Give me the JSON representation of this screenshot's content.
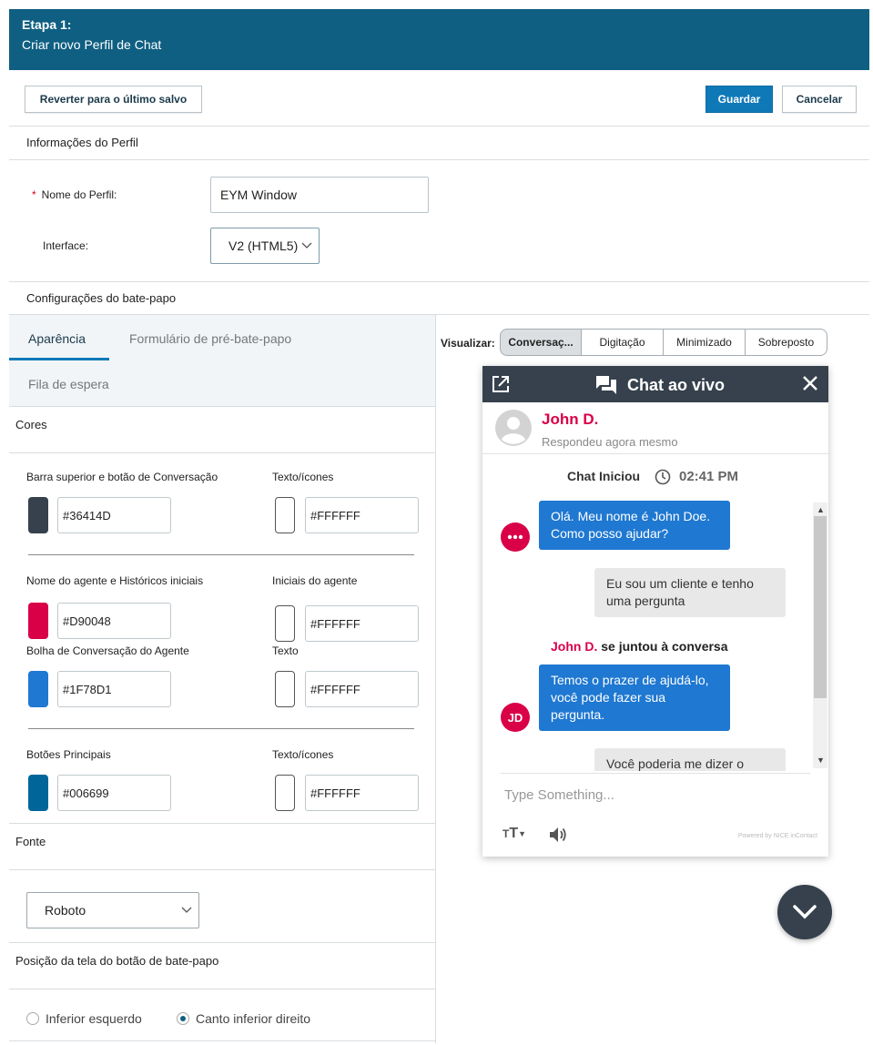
{
  "header": {
    "step": "Etapa 1:",
    "subtitle": "Criar novo Perfil de Chat"
  },
  "toolbar": {
    "revert_label": "Reverter para o último salvo",
    "save_label": "Guardar",
    "cancel_label": "Cancelar"
  },
  "profile_info": {
    "title": "Informações do Perfil",
    "name_label": "Nome do Perfil:",
    "name_value": "EYM Window",
    "interface_label": "Interface:",
    "interface_value": "V2 (HTML5)"
  },
  "chat_settings": {
    "title": "Configurações do bate-papo"
  },
  "tabs": [
    {
      "label": "Aparência",
      "active": true
    },
    {
      "label": "Formulário de pré-bate-papo",
      "active": false
    },
    {
      "label": "Fila de espera",
      "active": false
    }
  ],
  "colors": {
    "title": "Cores",
    "rows": [
      {
        "left_label": "Barra superior e botão de Conversação",
        "left_value": "#36414D",
        "left_color": "#36414D",
        "right_label": "Texto/ícones",
        "right_value": "#FFFFFF",
        "right_color": "#FFFFFF"
      },
      {
        "left_label": "Nome do agente e Históricos iniciais",
        "left_value": "#D90048",
        "left_color": "#D90048",
        "right_label": "Iniciais do agente",
        "right_value": "#FFFFFF",
        "right_color": "#FFFFFF"
      },
      {
        "left_label": "Bolha de Conversação do Agente",
        "left_value": "#1F78D1",
        "left_color": "#1F78D1",
        "right_label": "Texto",
        "right_value": "#FFFFFF",
        "right_color": "#FFFFFF"
      },
      {
        "left_label": "Botões Principais",
        "left_value": "#006699",
        "left_color": "#006699",
        "right_label": "Texto/ícones",
        "right_value": "#FFFFFF",
        "right_color": "#FFFFFF"
      }
    ]
  },
  "font": {
    "title": "Fonte",
    "value": "Roboto"
  },
  "position": {
    "title": "Posição da tela do botão de bate-papo",
    "options": [
      "Inferior esquerdo",
      "Canto inferior direito"
    ],
    "selected": 1
  },
  "preview": {
    "label": "Visualizar:",
    "modes": [
      "Conversaç...",
      "Digitação",
      "Minimizado",
      "Sobreposto"
    ],
    "active_mode": 0
  },
  "chat": {
    "title": "Chat ao vivo",
    "agent_name": "John D.",
    "agent_status": "Respondeu agora mesmo",
    "started_label": "Chat Iniciou",
    "started_time": "02:41 PM",
    "messages": [
      {
        "from": "agent",
        "text": "Olá. Meu nome é John Doe. Como posso ajudar?"
      },
      {
        "from": "user",
        "text": "Eu sou um cliente e tenho uma pergunta"
      },
      {
        "from": "agent",
        "text": "Temos o prazer de ajudá-lo, você pode fazer sua pergunta."
      },
      {
        "from": "user",
        "text": "Você poderia me dizer o"
      }
    ],
    "joined_name": "John D.",
    "joined_text": "se juntou à conversa",
    "agent_initials": "JD",
    "input_placeholder": "Type Something...",
    "powered_by": "Powered by NICE inContact"
  }
}
